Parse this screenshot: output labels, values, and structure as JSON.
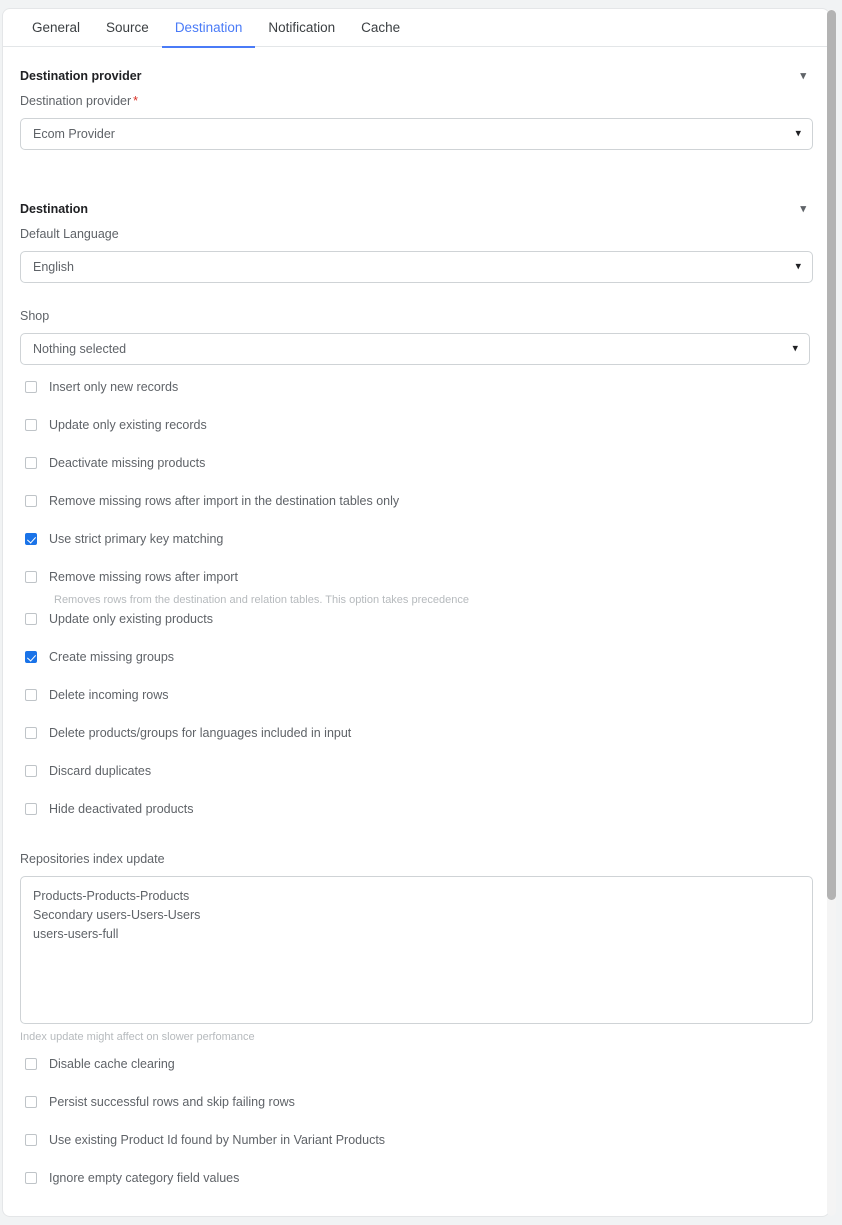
{
  "tabs": [
    {
      "label": "General",
      "active": false
    },
    {
      "label": "Source",
      "active": false
    },
    {
      "label": "Destination",
      "active": true
    },
    {
      "label": "Notification",
      "active": false
    },
    {
      "label": "Cache",
      "active": false
    }
  ],
  "colors": {
    "accent": "#4a7bf7",
    "checkbox_checked": "#1a73e8",
    "required_asterisk": "#d93025",
    "label_text": "#5f6368",
    "hint_text": "#b6babd"
  },
  "sections": {
    "destination_provider": {
      "header": "Destination provider",
      "collapse_icon": "chevron-down-icon",
      "field_label": "Destination provider",
      "required_marker": "*",
      "select_value": "Ecom Provider",
      "select_icon": "chevron-down-icon"
    },
    "destination": {
      "header": "Destination",
      "collapse_icon": "chevron-down-icon",
      "default_language": {
        "label": "Default Language",
        "value": "English",
        "select_icon": "chevron-down-icon"
      },
      "shop": {
        "label": "Shop",
        "value": "Nothing selected",
        "select_icon": "chevron-down-icon"
      }
    }
  },
  "checkboxes_upper": [
    {
      "label": "Insert only new records",
      "checked": false
    },
    {
      "label": "Update only existing records",
      "checked": false
    },
    {
      "label": "Deactivate missing products",
      "checked": false
    },
    {
      "label": "Remove missing rows after import in the destination tables only",
      "checked": false
    },
    {
      "label": "Use strict primary key matching",
      "checked": true
    },
    {
      "label": "Remove missing rows after import",
      "checked": false,
      "hint": "Removes rows from the destination and relation tables. This option takes precedence"
    },
    {
      "label": "Update only existing products",
      "checked": false
    },
    {
      "label": "Create missing groups",
      "checked": true
    },
    {
      "label": "Delete incoming rows",
      "checked": false
    },
    {
      "label": "Delete products/groups for languages included in input",
      "checked": false
    },
    {
      "label": "Discard duplicates",
      "checked": false
    },
    {
      "label": "Hide deactivated products",
      "checked": false
    }
  ],
  "repositories_index_update": {
    "label": "Repositories index update",
    "value": "Products-Products-Products\nSecondary users-Users-Users\nusers-users-full",
    "hint": "Index update might affect on slower perfomance"
  },
  "checkboxes_lower": [
    {
      "label": "Disable cache clearing",
      "checked": false
    },
    {
      "label": "Persist successful rows and skip failing rows",
      "checked": false
    },
    {
      "label": "Use existing Product Id found by Number in Variant Products",
      "checked": false
    },
    {
      "label": "Ignore empty category field values",
      "checked": false
    }
  ],
  "scrollbar": {
    "name": "vertical-scrollbar"
  }
}
